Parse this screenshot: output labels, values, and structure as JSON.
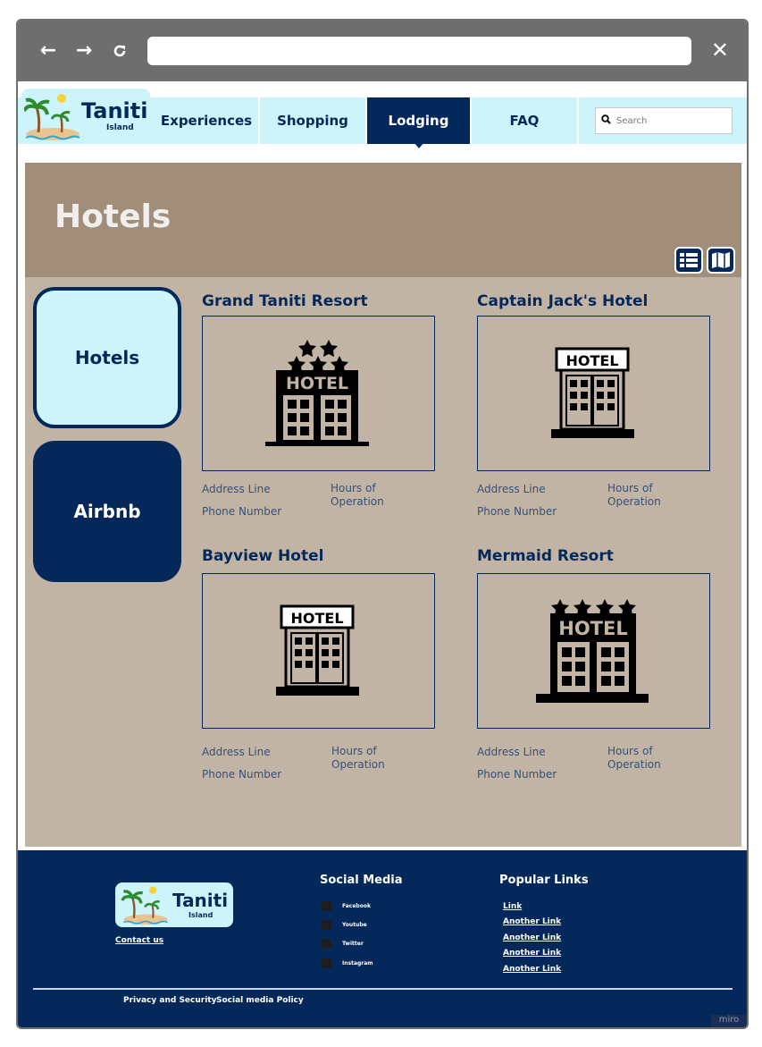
{
  "browser": {
    "back_icon": "←",
    "forward_icon": "→",
    "reload_icon": "C",
    "address": "",
    "close_icon": "✕"
  },
  "logo": {
    "name": "Taniti",
    "subtitle": "Island"
  },
  "nav": {
    "tabs": [
      {
        "label": "Experiences",
        "active": false
      },
      {
        "label": "Shopping",
        "active": false
      },
      {
        "label": "Lodging",
        "active": true
      },
      {
        "label": "FAQ",
        "active": false
      }
    ],
    "search_placeholder": "Search"
  },
  "hero": {
    "title": "Hotels"
  },
  "sidebar": {
    "items": [
      {
        "label": "Hotels",
        "selected": true
      },
      {
        "label": "Airbnb",
        "selected": false
      }
    ]
  },
  "hotels": [
    {
      "name": "Grand Taniti Resort",
      "stars": 5,
      "address": "Address Line",
      "phone": "Phone Number",
      "hours": "Hours of Operation"
    },
    {
      "name": "Captain Jack's Hotel",
      "stars": 0,
      "address": "Address Line",
      "phone": "Phone Number",
      "hours": "Hours of Operation"
    },
    {
      "name": "Bayview Hotel",
      "stars": 0,
      "address": "Address Line",
      "phone": "Phone Number",
      "hours": "Hours of Operation"
    },
    {
      "name": "Mermaid Resort",
      "stars": 4,
      "address": "Address Line",
      "phone": "Phone Number",
      "hours": "Hours of Operation"
    }
  ],
  "hotel_sign": "HOTEL",
  "footer": {
    "logo_name": "Taniti",
    "logo_subtitle": "Island",
    "contact": "Contact us",
    "social_heading": "Social Media",
    "social": [
      "Facebook",
      "Youtube",
      "Twitter",
      "Instagram"
    ],
    "links_heading": "Popular Links",
    "links": [
      "Link",
      "Another Link",
      "Another Link",
      "Another Link",
      "Another Link"
    ],
    "legal": [
      "Privacy and Security",
      "Social media Policy"
    ]
  },
  "watermark": "miro",
  "colors": {
    "navy": "#05285a",
    "light_blue": "#cdf4fb",
    "tan": "#c2b4a4",
    "hero_tan": "#a08e7a"
  }
}
